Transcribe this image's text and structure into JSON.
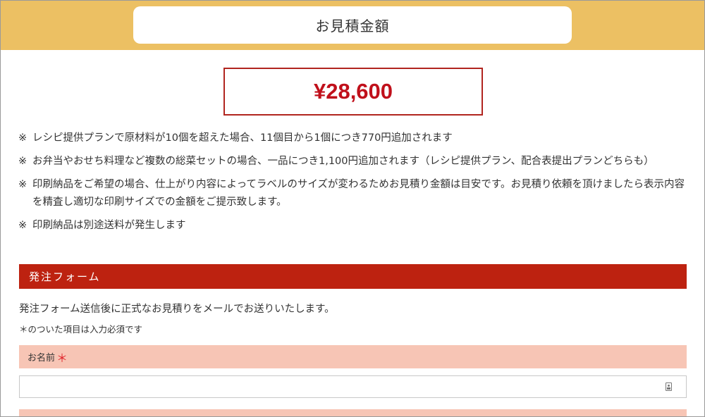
{
  "header": {
    "title": "お見積金額"
  },
  "price": {
    "amount": "¥28,600"
  },
  "notes": {
    "mark": "※",
    "items": [
      "レシピ提供プランで原材料が10個を超えた場合、11個目から1個につき770円追加されます",
      "お弁当やおせち料理など複数の総菜セットの場合、一品につき1,100円追加されます（レシピ提供プラン、配合表提出プランどちらも）",
      "印刷納品をご希望の場合、仕上がり内容によってラベルのサイズが変わるためお見積り金額は目安です。お見積り依頼を頂けましたら表示内容を精査し適切な印刷サイズでの金額をご提示致します。",
      "印刷納品は別途送料が発生します"
    ]
  },
  "form": {
    "section_title": "発注フォーム",
    "intro": "発注フォーム送信後に正式なお見積りをメールでお送りいたします。",
    "required_note": "＊のついた項目は入力必須です",
    "name_label": "お名前",
    "required_mark": "＊",
    "name_value": "",
    "name_icon": "contact-card-icon"
  },
  "colors": {
    "header_band": "#ecc063",
    "price_text": "#c0101b",
    "section_header": "#bd2210",
    "field_label_bg": "#f7c5b5",
    "required_star": "#e0262c"
  }
}
